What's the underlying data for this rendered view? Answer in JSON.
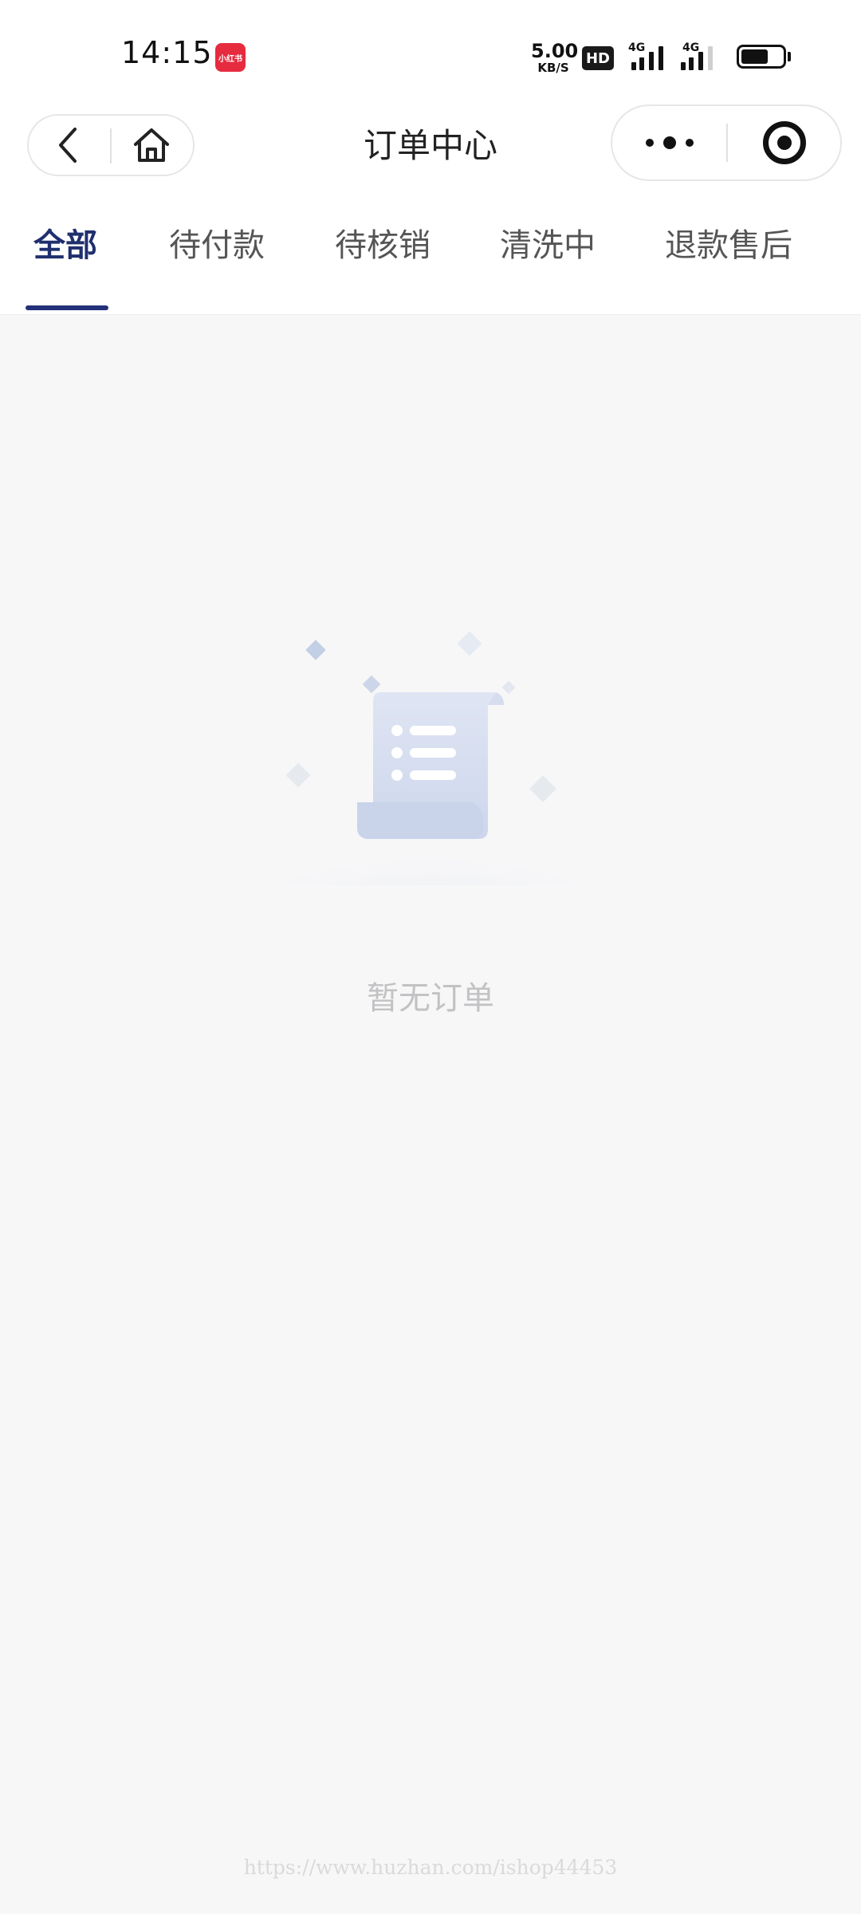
{
  "status_bar": {
    "time": "14:15",
    "app_badge": "小红书",
    "net_speed_value": "5.00",
    "net_speed_unit": "KB/S",
    "hd_label": "HD",
    "signal_1_label": "4G",
    "signal_2_label": "4G",
    "battery_level": 0.65
  },
  "nav": {
    "title": "订单中心",
    "back_icon": "chevron-left-icon",
    "home_icon": "home-icon",
    "more_icon": "more-dots-icon",
    "close_icon": "target-icon"
  },
  "tabs": [
    {
      "label": "全部",
      "active": true
    },
    {
      "label": "待付款",
      "active": false
    },
    {
      "label": "待核销",
      "active": false
    },
    {
      "label": "清洗中",
      "active": false
    },
    {
      "label": "退款售后",
      "active": false
    }
  ],
  "empty_state": {
    "icon": "empty-scroll-icon",
    "text": "暂无订单"
  },
  "watermark": "https://www.huzhan.com/ishop44453",
  "colors": {
    "accent": "#24307a",
    "active_tab_text": "#1f2f6e",
    "background": "#f7f7f8",
    "empty_text": "#c2c2c4",
    "app_badge": "#e62b3f"
  }
}
